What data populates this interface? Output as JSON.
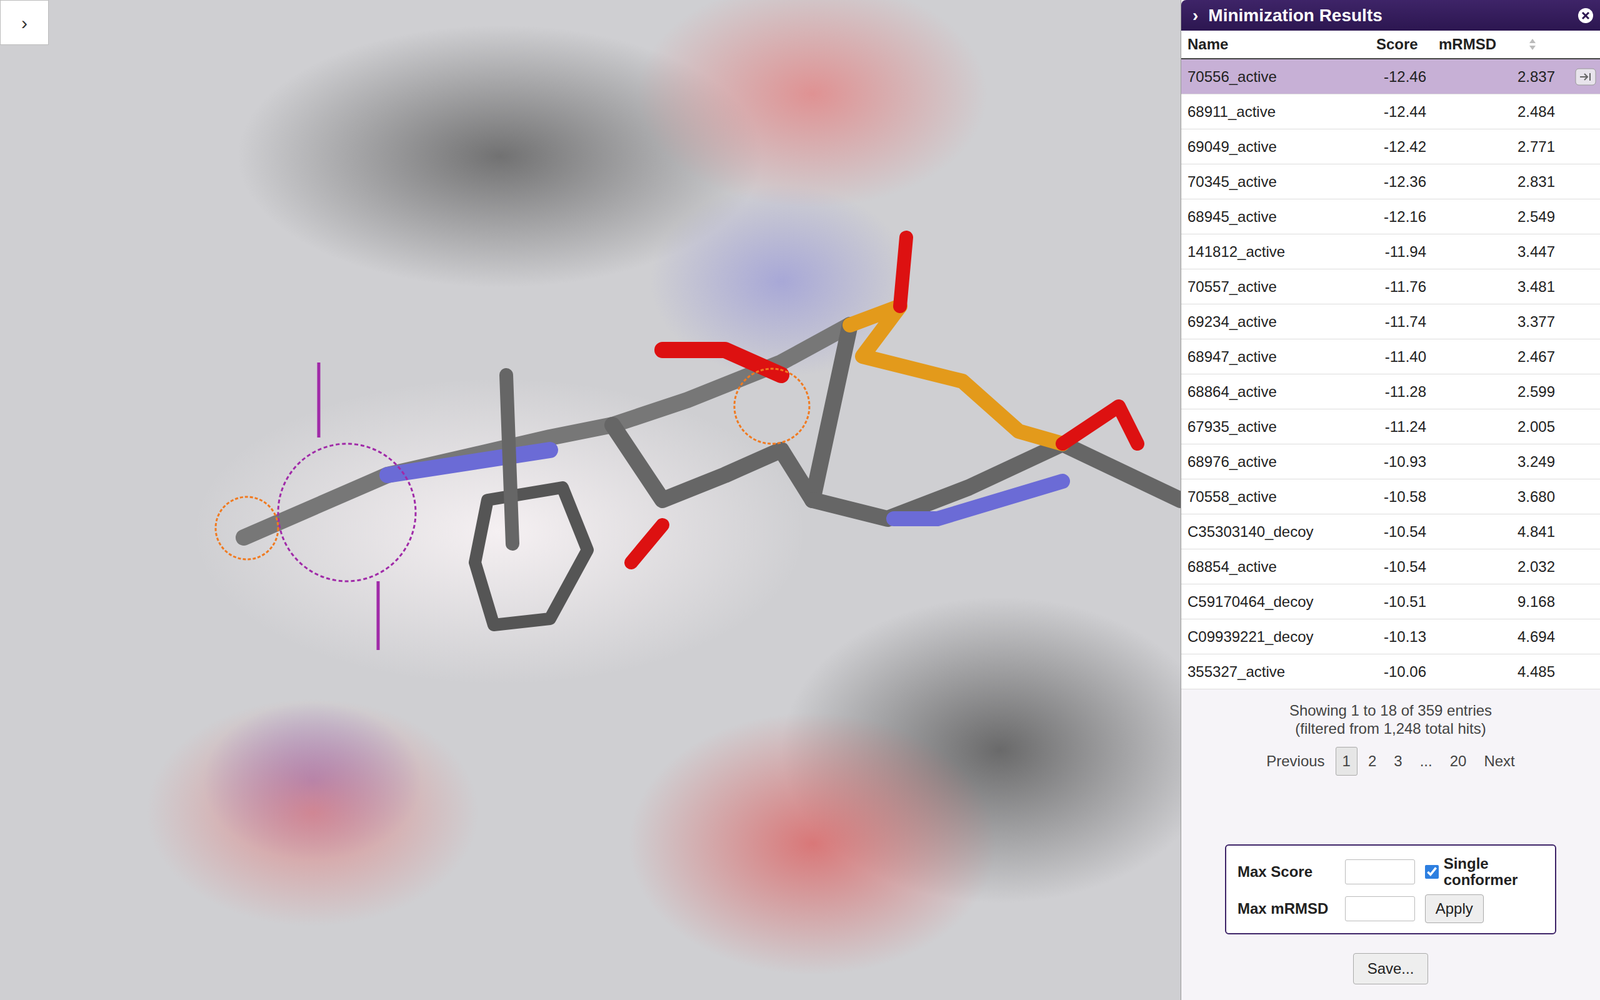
{
  "viewer": {
    "toggle": "›"
  },
  "panel": {
    "toggle": "›",
    "title": "Minimization Results"
  },
  "table": {
    "columns": [
      {
        "label": "Name",
        "kind": "none"
      },
      {
        "label": "Score",
        "kind": "asc"
      },
      {
        "label": "mRMSD",
        "kind": "both"
      }
    ],
    "rows": [
      {
        "name": "70556_active",
        "score": "-12.46",
        "rmsd": "2.837",
        "selected": true
      },
      {
        "name": "68911_active",
        "score": "-12.44",
        "rmsd": "2.484",
        "selected": false
      },
      {
        "name": "69049_active",
        "score": "-12.42",
        "rmsd": "2.771",
        "selected": false
      },
      {
        "name": "70345_active",
        "score": "-12.36",
        "rmsd": "2.831",
        "selected": false
      },
      {
        "name": "68945_active",
        "score": "-12.16",
        "rmsd": "2.549",
        "selected": false
      },
      {
        "name": "141812_active",
        "score": "-11.94",
        "rmsd": "3.447",
        "selected": false
      },
      {
        "name": "70557_active",
        "score": "-11.76",
        "rmsd": "3.481",
        "selected": false
      },
      {
        "name": "69234_active",
        "score": "-11.74",
        "rmsd": "3.377",
        "selected": false
      },
      {
        "name": "68947_active",
        "score": "-11.40",
        "rmsd": "2.467",
        "selected": false
      },
      {
        "name": "68864_active",
        "score": "-11.28",
        "rmsd": "2.599",
        "selected": false
      },
      {
        "name": "67935_active",
        "score": "-11.24",
        "rmsd": "2.005",
        "selected": false
      },
      {
        "name": "68976_active",
        "score": "-10.93",
        "rmsd": "3.249",
        "selected": false
      },
      {
        "name": "70558_active",
        "score": "-10.58",
        "rmsd": "3.680",
        "selected": false
      },
      {
        "name": "C35303140_decoy",
        "score": "-10.54",
        "rmsd": "4.841",
        "selected": false
      },
      {
        "name": "68854_active",
        "score": "-10.54",
        "rmsd": "2.032",
        "selected": false
      },
      {
        "name": "C59170464_decoy",
        "score": "-10.51",
        "rmsd": "9.168",
        "selected": false
      },
      {
        "name": "C09939221_decoy",
        "score": "-10.13",
        "rmsd": "4.694",
        "selected": false
      },
      {
        "name": "355327_active",
        "score": "-10.06",
        "rmsd": "4.485",
        "selected": false
      }
    ]
  },
  "info": [
    "Showing 1 to 18 of 359 entries",
    "(filtered from 1,248 total hits)"
  ],
  "pagination": [
    {
      "label": "Previous",
      "selected": false
    },
    {
      "label": "1",
      "selected": true
    },
    {
      "label": "2",
      "selected": false
    },
    {
      "label": "3",
      "selected": false
    },
    {
      "label": "...",
      "selected": false
    },
    {
      "label": "20",
      "selected": false
    },
    {
      "label": "Next",
      "selected": false
    }
  ],
  "filters": {
    "max_score": {
      "label": "Max Score"
    },
    "max_rmsd": {
      "label": "Max mRMSD"
    },
    "single_conformer": {
      "label": "Single conformer",
      "checked": true
    },
    "apply": "Apply"
  },
  "save": "Save..."
}
